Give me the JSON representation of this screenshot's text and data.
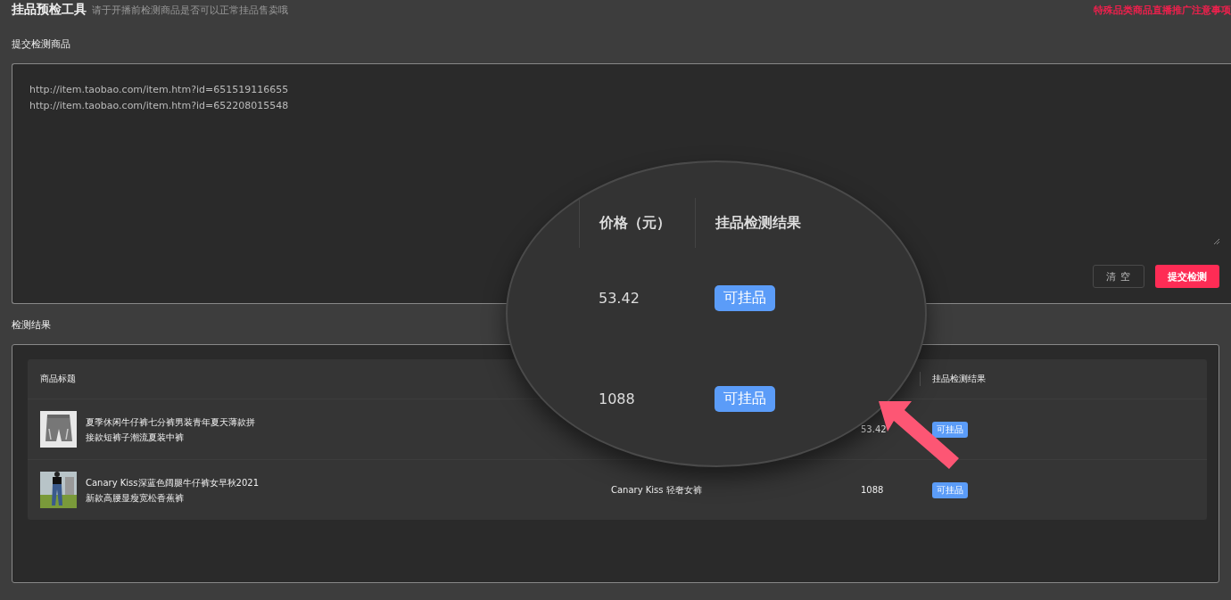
{
  "header": {
    "title": "挂品预检工具",
    "subtitle": "请于开播前检测商品是否可以正常挂品售卖哦",
    "notice_link": "特殊品类商品直播推广注意事项"
  },
  "submit_section": {
    "label": "提交检测商品",
    "urls": [
      "http://item.taobao.com/item.htm?id=651519116655",
      "http://item.taobao.com/item.htm?id=652208015548"
    ],
    "buttons": [
      {
        "label": "清 空",
        "kind": "secondary"
      },
      {
        "label": "提交检测",
        "kind": "primary"
      }
    ]
  },
  "results_section": {
    "label": "检测结果",
    "table": {
      "columns": [
        {
          "label": "商品标题"
        },
        {},
        {},
        {
          "label": "挂品检测结果"
        }
      ],
      "rows": [
        {
          "title_lines": [
            "夏季休闲牛仔裤七分裤男装青年夏天薄款拼",
            "接款短裤子潮流夏装中裤"
          ],
          "price": "53.42",
          "result": "可挂品"
        },
        {
          "title_lines": [
            "Canary Kiss深蓝色阔腿牛仔裤女早秋2021",
            "新款高腰显瘦宽松香蕉裤"
          ],
          "column_2": "Canary Kiss 轻奢女裤",
          "price": "1088",
          "result": "可挂品"
        }
      ]
    }
  },
  "magnifier": {
    "columns": [
      "价格（元）",
      "挂品检测结果"
    ],
    "rows": [
      {
        "price": "53.42",
        "result": "可挂品"
      },
      {
        "price": "1088",
        "result": "可挂品"
      }
    ]
  }
}
